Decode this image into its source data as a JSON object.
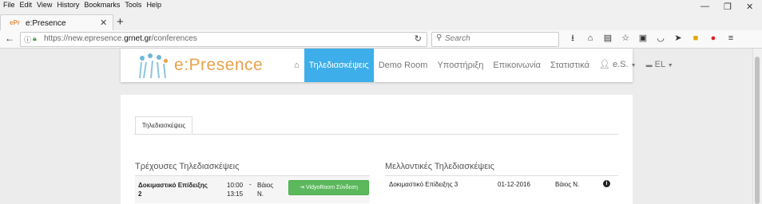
{
  "menu": [
    "File",
    "Edit",
    "View",
    "History",
    "Bookmarks",
    "Tools",
    "Help"
  ],
  "tab": {
    "title": "e:Presence",
    "favicon": "ePr"
  },
  "window_controls": {
    "minimize": "—",
    "restore": "❐",
    "close": "✕"
  },
  "urlbar": {
    "prefix": "https://new.epresence.",
    "domain": "grnet.gr",
    "path": "/conferences"
  },
  "search": {
    "placeholder": "Search"
  },
  "site": {
    "logo_text": "e:Presence",
    "nav": [
      {
        "label": "Τηλεδιασκέψεις",
        "active": true
      },
      {
        "label": "Demo Room"
      },
      {
        "label": "Υποστήριξη"
      },
      {
        "label": "Επικοινωνία"
      },
      {
        "label": "Στατιστικά"
      }
    ],
    "user_menu": "e.S.",
    "lang_menu": "EL"
  },
  "panel": {
    "tab_label": "Τηλεδιασκέψεις",
    "current": {
      "title": "Τρέχουσες Τηλεδιασκέψεις",
      "rows": [
        {
          "name": "Δοκιμαστικό Επίδειξης 2",
          "start": "10:00",
          "end": "13:15",
          "dash": "-",
          "organizer": "Βάιος Ν.",
          "button": "VidyoRoom Σύνδεση"
        }
      ]
    },
    "upcoming": {
      "title": "Μελλοντικές Τηλεδιασκέψεις",
      "rows": [
        {
          "name": "Δοκιμαστικό Επίδειξης 3",
          "date": "01-12-2016",
          "organizer": "Βάιος Ν."
        }
      ]
    }
  },
  "colors": {
    "accent": "#3daee9",
    "button_green": "#5cb85c",
    "logo_orange": "#e8a24b"
  }
}
